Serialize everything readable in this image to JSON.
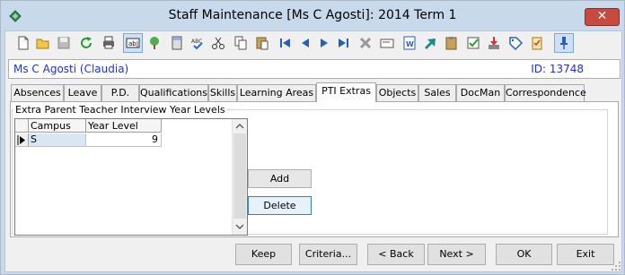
{
  "window": {
    "title": "Staff Maintenance  [Ms C Agosti]:  2014 Term 1",
    "close_glyph": "✕"
  },
  "toolbar": {
    "buttons": [
      {
        "name": "new-document-icon"
      },
      {
        "name": "open-folder-icon"
      },
      {
        "name": "save-disk-icon"
      },
      {
        "name": "refresh-icon"
      },
      {
        "name": "print-icon"
      },
      {
        "name": "text-field-icon",
        "label": "ab|",
        "active": true
      },
      {
        "name": "tree-icon"
      },
      {
        "name": "calculator-icon"
      },
      {
        "name": "spellcheck-icon",
        "label": "ABC"
      },
      {
        "name": "cut-icon"
      },
      {
        "name": "copy-icon"
      },
      {
        "name": "paste-icon"
      },
      {
        "name": "first-record-icon"
      },
      {
        "name": "previous-record-icon"
      },
      {
        "name": "next-record-icon"
      },
      {
        "name": "last-record-icon"
      },
      {
        "name": "delete-icon"
      },
      {
        "name": "card-icon"
      },
      {
        "name": "word-export-icon"
      },
      {
        "name": "arrow-forward-icon"
      },
      {
        "name": "clipboard-icon"
      },
      {
        "name": "approve-icon"
      },
      {
        "name": "download-tray-icon"
      },
      {
        "name": "tag-icon"
      },
      {
        "name": "checklist-icon"
      },
      {
        "name": "pin-icon",
        "active": true
      }
    ]
  },
  "staff": {
    "name": "Ms C Agosti (Claudia)",
    "id_text": "ID: 13748"
  },
  "tabs": [
    {
      "label": "Absences"
    },
    {
      "label": "Leave"
    },
    {
      "label": "P.D."
    },
    {
      "label": "Qualifications"
    },
    {
      "label": "Skills"
    },
    {
      "label": "Learning Areas"
    },
    {
      "label": "PTI Extras",
      "active": true
    },
    {
      "label": "Objects"
    },
    {
      "label": "Sales"
    },
    {
      "label": "DocMan"
    },
    {
      "label": "Correspondence"
    }
  ],
  "pti": {
    "group_label": "Extra Parent Teacher Interview Year Levels",
    "columns": [
      "Campus",
      "Year Level"
    ],
    "rows": [
      {
        "campus": "S",
        "year_level": "9"
      }
    ],
    "add_label": "Add",
    "delete_label": "Delete"
  },
  "footer": {
    "keep": "Keep",
    "criteria": "Criteria...",
    "back": "< Back",
    "next": "Next >",
    "ok": "OK",
    "exit": "Exit"
  },
  "colors": {
    "title_bg": "#c9d9ec",
    "link_blue": "#1d2fd4",
    "close_red": "#c64a3f",
    "selected_cell": "#dbe6f4"
  }
}
